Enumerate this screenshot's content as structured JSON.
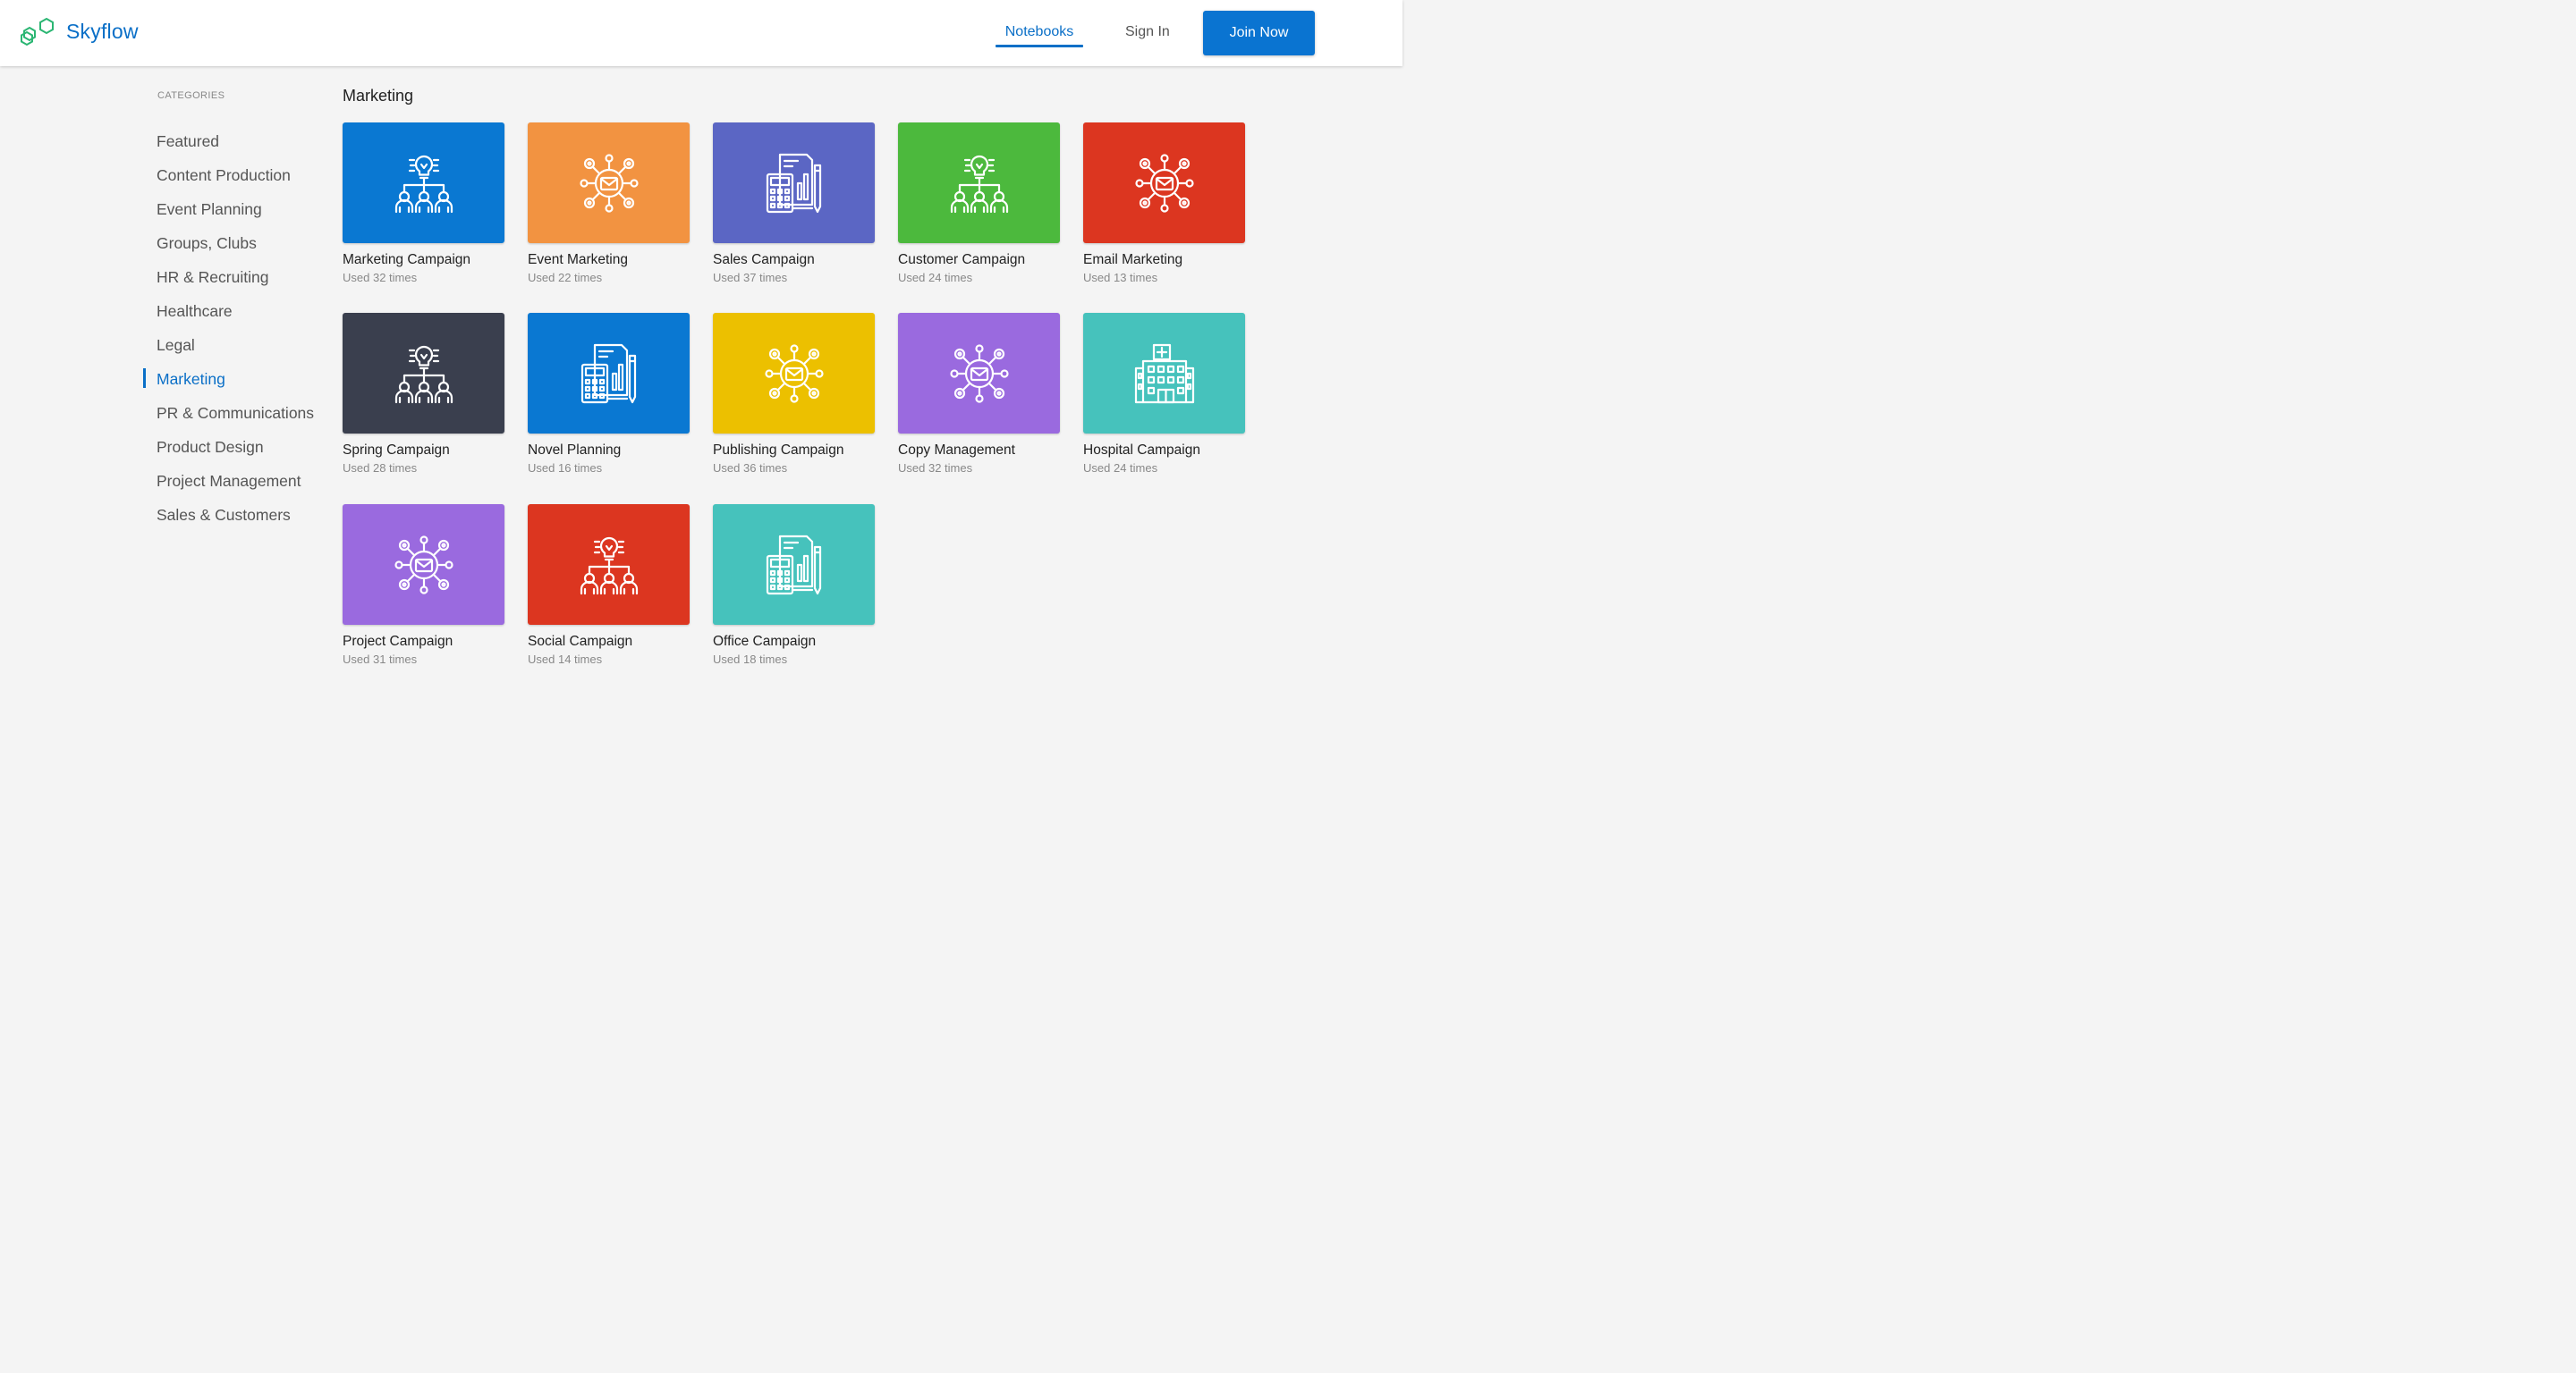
{
  "app": {
    "brand": "Skyflow",
    "logo_icon": "hexagons-logo-icon",
    "accent": "#0a6fc7"
  },
  "nav": {
    "notebooks": "Notebooks",
    "sign_in": "Sign In",
    "join": "Join Now"
  },
  "sidebar": {
    "heading": "CATEGORIES",
    "items": [
      {
        "label": "Featured"
      },
      {
        "label": "Content Production"
      },
      {
        "label": "Event Planning"
      },
      {
        "label": "Groups, Clubs"
      },
      {
        "label": "HR & Recruiting"
      },
      {
        "label": "Healthcare"
      },
      {
        "label": "Legal"
      },
      {
        "label": "Marketing",
        "active": true
      },
      {
        "label": "PR & Communications"
      },
      {
        "label": "Product Design"
      },
      {
        "label": "Project Management"
      },
      {
        "label": "Sales & Customers"
      }
    ]
  },
  "main": {
    "title": "Marketing",
    "templates": [
      {
        "title": "Marketing Campaign",
        "usage": "Used 32 times",
        "color": "#0a78d2",
        "icon": "idea-team-icon"
      },
      {
        "title": "Event Marketing",
        "usage": "Used 22 times",
        "color": "#f29341",
        "icon": "email-network-icon"
      },
      {
        "title": "Sales Campaign",
        "usage": "Used 37 times",
        "color": "#5b66c4",
        "icon": "calculator-report-icon"
      },
      {
        "title": "Customer Campaign",
        "usage": "Used 24 times",
        "color": "#4cb93d",
        "icon": "idea-team-icon"
      },
      {
        "title": "Email Marketing",
        "usage": "Used 13 times",
        "color": "#dc3620",
        "icon": "email-network-icon"
      },
      {
        "title": "Spring Campaign",
        "usage": "Used 28 times",
        "color": "#3a3f4e",
        "icon": "idea-team-icon"
      },
      {
        "title": "Novel Planning",
        "usage": "Used 16 times",
        "color": "#0a78d2",
        "icon": "calculator-report-icon"
      },
      {
        "title": "Publishing Campaign",
        "usage": "Used 36 times",
        "color": "#ecc000",
        "icon": "email-network-icon"
      },
      {
        "title": "Copy Management",
        "usage": "Used 32 times",
        "color": "#9a6adf",
        "icon": "email-network-icon"
      },
      {
        "title": "Hospital Campaign",
        "usage": "Used 24 times",
        "color": "#46c2bc",
        "icon": "hospital-building-icon"
      },
      {
        "title": "Project Campaign",
        "usage": "Used 31 times",
        "color": "#9a6adf",
        "icon": "email-network-icon"
      },
      {
        "title": "Social Campaign",
        "usage": "Used 14 times",
        "color": "#dc3620",
        "icon": "idea-team-icon"
      },
      {
        "title": "Office Campaign",
        "usage": "Used 18 times",
        "color": "#46c2bc",
        "icon": "calculator-report-icon"
      }
    ]
  }
}
